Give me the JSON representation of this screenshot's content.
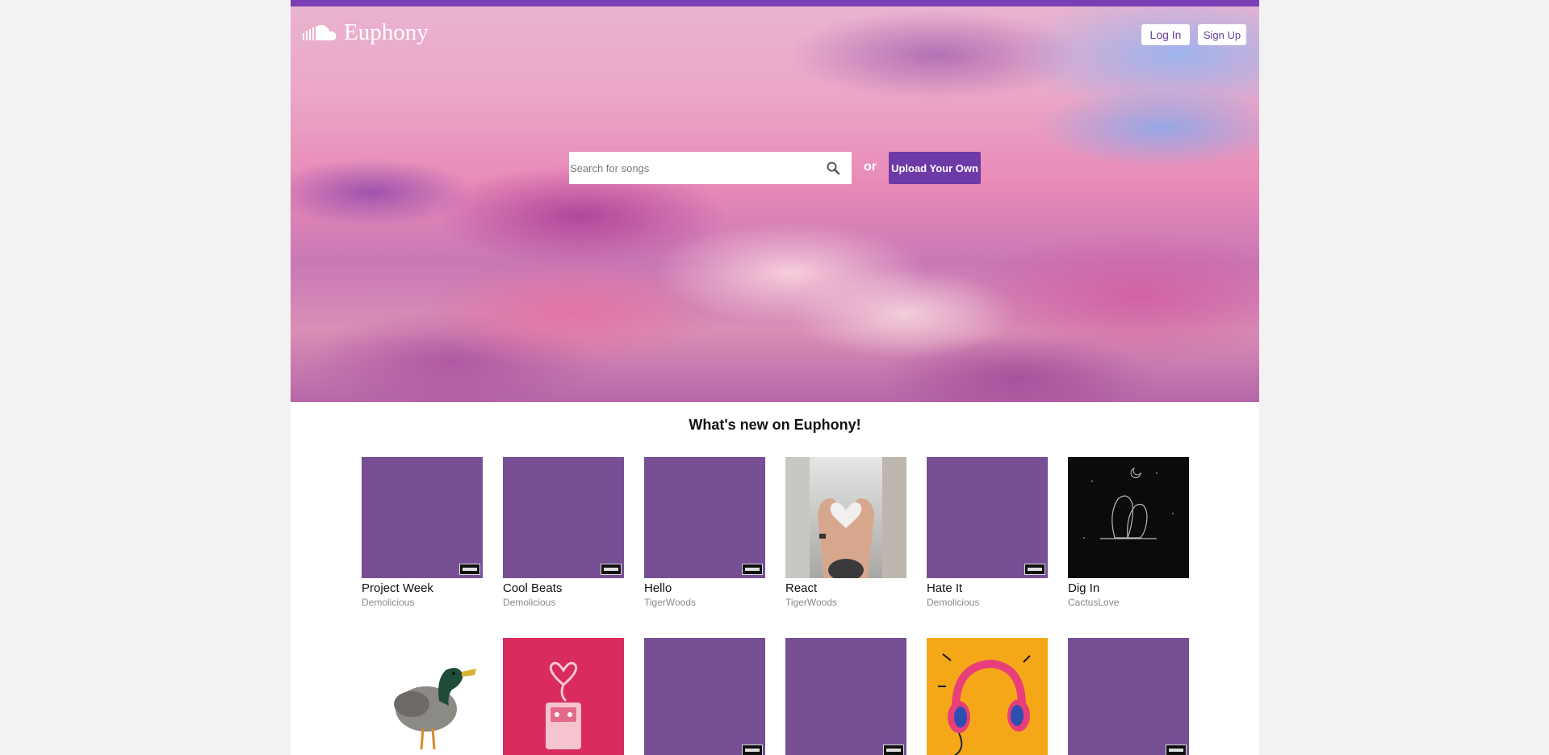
{
  "brand": {
    "name": "Euphony",
    "icon": "cloud-icon",
    "accent_color": "#7b3fb5",
    "button_color": "#6d3aa8"
  },
  "header": {
    "login_label": "Log In",
    "signup_label": "Sign Up"
  },
  "hero": {
    "search": {
      "placeholder": "Search for songs",
      "icon": "search-icon"
    },
    "or_label": "or",
    "upload_label": "Upload Your Own"
  },
  "section": {
    "title": "What's new on Euphony!"
  },
  "songs_row1": [
    {
      "title": "Project Week",
      "artist": "Demolicious",
      "art": "purple-placeholder"
    },
    {
      "title": "Cool Beats",
      "artist": "Demolicious",
      "art": "purple-placeholder"
    },
    {
      "title": "Hello",
      "artist": "TigerWoods",
      "art": "purple-placeholder"
    },
    {
      "title": "React",
      "artist": "TigerWoods",
      "art": "heart-hands"
    },
    {
      "title": "Hate It",
      "artist": "Demolicious",
      "art": "purple-placeholder"
    },
    {
      "title": "Dig In",
      "artist": "CactusLove",
      "art": "night-sketch"
    }
  ],
  "songs_row2": [
    {
      "art": "duck"
    },
    {
      "art": "cassette-heart"
    },
    {
      "art": "purple-placeholder"
    },
    {
      "art": "purple-placeholder"
    },
    {
      "art": "headphones"
    },
    {
      "art": "purple-placeholder"
    }
  ]
}
